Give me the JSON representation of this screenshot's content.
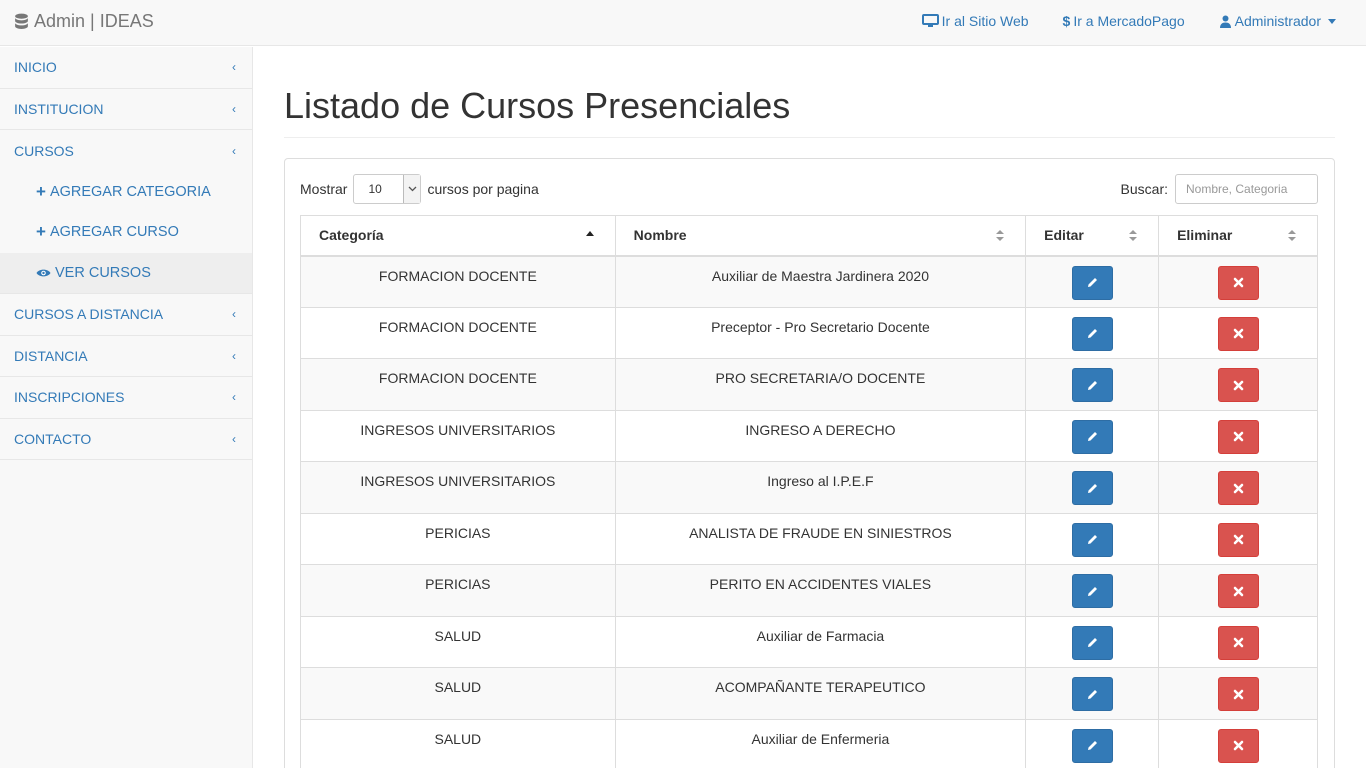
{
  "navbar": {
    "brand": "Admin | IDEAS",
    "links": {
      "site": "Ir al Sitio Web",
      "mercadopago": "Ir a MercadoPago",
      "user": "Administrador"
    }
  },
  "sidebar": {
    "items": {
      "inicio": "INICIO",
      "institucion": "INSTITUCION",
      "cursos": "CURSOS",
      "cursos_distancia": "CURSOS A DISTANCIA",
      "distancia": "DISTANCIA",
      "inscripciones": "INSCRIPCIONES",
      "contacto": "CONTACTO"
    },
    "sub_items": {
      "agregar_categoria": "AGREGAR CATEGORIA",
      "agregar_curso": "AGREGAR CURSO",
      "ver_cursos": "VER CURSOS"
    }
  },
  "main": {
    "title": "Listado de Cursos Presenciales",
    "show_label": "Mostrar",
    "page_size": "10",
    "per_page_label": "cursos por pagina",
    "search_label": "Buscar:",
    "search_placeholder": "Nombre, Categoria"
  },
  "table": {
    "headers": {
      "categoria": "Categoría",
      "nombre": "Nombre",
      "editar": "Editar",
      "eliminar": "Eliminar"
    },
    "rows": [
      {
        "categoria": "FORMACION DOCENTE",
        "nombre": "Auxiliar de Maestra Jardinera 2020"
      },
      {
        "categoria": "FORMACION DOCENTE",
        "nombre": "Preceptor - Pro Secretario Docente"
      },
      {
        "categoria": "FORMACION DOCENTE",
        "nombre": "PRO SECRETARIA/O DOCENTE"
      },
      {
        "categoria": "INGRESOS UNIVERSITARIOS",
        "nombre": "INGRESO A DERECHO"
      },
      {
        "categoria": "INGRESOS UNIVERSITARIOS",
        "nombre": "Ingreso al I.P.E.F"
      },
      {
        "categoria": "PERICIAS",
        "nombre": "ANALISTA DE FRAUDE EN SINIESTROS"
      },
      {
        "categoria": "PERICIAS",
        "nombre": "PERITO EN ACCIDENTES VIALES"
      },
      {
        "categoria": "SALUD",
        "nombre": "Auxiliar de Farmacia"
      },
      {
        "categoria": "SALUD",
        "nombre": "ACOMPAÑANTE TERAPEUTICO"
      },
      {
        "categoria": "SALUD",
        "nombre": "Auxiliar de Enfermeria"
      }
    ]
  },
  "colors": {
    "link": "#337ab7",
    "edit_button": "#337ab7",
    "delete_button": "#d9534f"
  }
}
